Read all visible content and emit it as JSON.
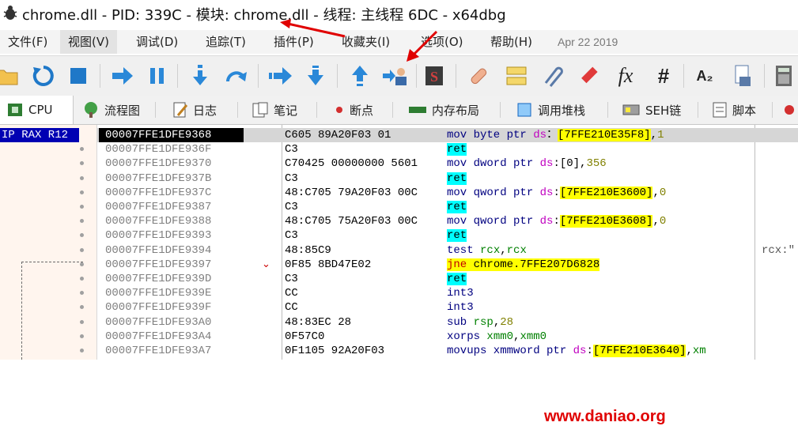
{
  "window": {
    "title": "chrome.dll - PID: 339C - 模块: chrome.dll - 线程: 主线程 6DC - x64dbg"
  },
  "menu": {
    "items": [
      "文件(F)",
      "视图(V)",
      "调试(D)",
      "追踪(T)",
      "插件(P)",
      "收藏夹(I)",
      "选项(O)",
      "帮助(H)"
    ],
    "date": "Apr 22 2019"
  },
  "toolbar": {
    "icons": [
      "open-folder-icon",
      "restart-icon",
      "stop-icon",
      "run-icon",
      "pause-icon",
      "step-into-icon",
      "step-over-icon",
      "trace-into-icon",
      "trace-over-icon",
      "execute-till-return-icon",
      "run-to-user-code-icon",
      "script-icon",
      "patch-icon",
      "comment-icon",
      "label-icon",
      "bookmark-icon",
      "function-icon",
      "hash-icon",
      "font-icon",
      "calculator-icon"
    ],
    "function_label": "fx",
    "hash_label": "#",
    "font_label": "A₂",
    "script_label": "S"
  },
  "tabs": [
    "CPU",
    "流程图",
    "日志",
    "笔记",
    "断点",
    "内存布局",
    "调用堆栈",
    "SEH链",
    "脚本"
  ],
  "registers": {
    "label": "IP RAX R12"
  },
  "rows": [
    {
      "addr": "00007FFE1DFE9368",
      "bytes": "C605 89A20F03 01",
      "arrow": "",
      "asm": [
        [
          "kw",
          "mov byte ptr "
        ],
        [
          "seg",
          "ds"
        ],
        [
          "",
          "："
        ],
        [
          "addrhl",
          "[7FFE210E35F8]"
        ],
        [
          "",
          ","
        ],
        [
          "num",
          "1"
        ]
      ]
    },
    {
      "addr": "00007FFE1DFE936F",
      "bytes": "C3",
      "arrow": "",
      "asm": [
        [
          "mn-ret",
          "ret"
        ]
      ]
    },
    {
      "addr": "00007FFE1DFE9370",
      "bytes": "C70425 00000000 5601",
      "arrow": "",
      "asm": [
        [
          "kw",
          "mov dword ptr "
        ],
        [
          "seg",
          "ds"
        ],
        [
          "",
          ":[0],"
        ],
        [
          "num",
          "356"
        ]
      ]
    },
    {
      "addr": "00007FFE1DFE937B",
      "bytes": "C3",
      "arrow": "",
      "asm": [
        [
          "mn-ret",
          "ret"
        ]
      ]
    },
    {
      "addr": "00007FFE1DFE937C",
      "bytes": "48:C705 79A20F03 00C",
      "arrow": "",
      "asm": [
        [
          "kw",
          "mov qword ptr "
        ],
        [
          "seg",
          "ds"
        ],
        [
          "",
          ":"
        ],
        [
          "addrhl",
          "[7FFE210E3600]"
        ],
        [
          "",
          ","
        ],
        [
          "num",
          "0"
        ]
      ]
    },
    {
      "addr": "00007FFE1DFE9387",
      "bytes": "C3",
      "arrow": "",
      "asm": [
        [
          "mn-ret",
          "ret"
        ]
      ]
    },
    {
      "addr": "00007FFE1DFE9388",
      "bytes": "48:C705 75A20F03 00C",
      "arrow": "",
      "asm": [
        [
          "kw",
          "mov qword ptr "
        ],
        [
          "seg",
          "ds"
        ],
        [
          "",
          ":"
        ],
        [
          "addrhl",
          "[7FFE210E3608]"
        ],
        [
          "",
          ","
        ],
        [
          "num",
          "0"
        ]
      ]
    },
    {
      "addr": "00007FFE1DFE9393",
      "bytes": "C3",
      "arrow": "",
      "asm": [
        [
          "mn-ret",
          "ret"
        ]
      ]
    },
    {
      "addr": "00007FFE1DFE9394",
      "bytes": "48:85C9",
      "arrow": "",
      "asm": [
        [
          "kw",
          "test "
        ],
        [
          "reg",
          "rcx"
        ],
        [
          "",
          ","
        ],
        [
          "reg",
          "rcx"
        ]
      ],
      "comment": "rcx:\""
    },
    {
      "addr": "00007FFE1DFE9397",
      "bytes": "0F85 8BD47E02",
      "arrow": "⌄",
      "asm": [
        [
          "mn-jne",
          "jne"
        ],
        [
          "",
          ""
        ],
        [
          "addrhl",
          " chrome.7FFE207D6828"
        ]
      ]
    },
    {
      "addr": "00007FFE1DFE939D",
      "bytes": "C3",
      "arrow": "",
      "asm": [
        [
          "mn-ret",
          "ret"
        ]
      ]
    },
    {
      "addr": "00007FFE1DFE939E",
      "bytes": "CC",
      "arrow": "",
      "asm": [
        [
          "kw",
          "int3"
        ]
      ]
    },
    {
      "addr": "00007FFE1DFE939F",
      "bytes": "CC",
      "arrow": "",
      "asm": [
        [
          "kw",
          "int3"
        ]
      ]
    },
    {
      "addr": "00007FFE1DFE93A0",
      "bytes": "48:83EC 28",
      "arrow": "",
      "asm": [
        [
          "kw",
          "sub "
        ],
        [
          "reg",
          "rsp"
        ],
        [
          "",
          ","
        ],
        [
          "num",
          "28"
        ]
      ]
    },
    {
      "addr": "00007FFE1DFE93A4",
      "bytes": "0F57C0",
      "arrow": "",
      "asm": [
        [
          "kw",
          "xorps "
        ],
        [
          "reg",
          "xmm0"
        ],
        [
          "",
          ","
        ],
        [
          "reg",
          "xmm0"
        ]
      ]
    },
    {
      "addr": "00007FFE1DFE93A7",
      "bytes": "0F1105 92A20F03",
      "arrow": "",
      "asm": [
        [
          "kw",
          "movups xmmword ptr "
        ],
        [
          "seg",
          "ds"
        ],
        [
          "",
          ":"
        ],
        [
          "addrhl",
          "[7FFE210E3640]"
        ],
        [
          "",
          ","
        ],
        [
          "reg",
          "xm"
        ]
      ]
    }
  ],
  "watermark": "www.daniao.org",
  "colors": {
    "selection": "#000000",
    "ret_highlight": "#00ffff",
    "address_highlight": "#ffff00",
    "watermark": "#e00000"
  }
}
